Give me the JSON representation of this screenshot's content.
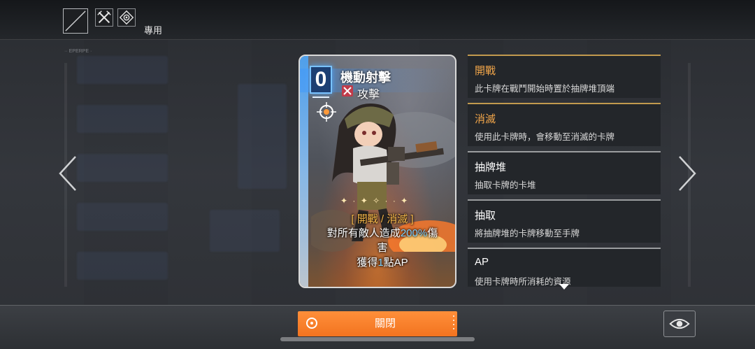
{
  "header": {
    "filter_icons": [
      "empty-slash-icon",
      "crossed-swords-icon",
      "target-icon"
    ],
    "filter_label": "專用",
    "small_caption": "·· EPERPE ·"
  },
  "card": {
    "cost": "0",
    "name": "機動射擊",
    "type_icon": "crossed-swords-icon",
    "type": "攻擊",
    "tags": "[ 開戰 / 消滅 ]",
    "effect_line1_pre": "對所有敵人造成",
    "effect_line1_value": "200%",
    "effect_line1_post": "傷",
    "effect_line2": "害",
    "effect_line3_pre": "獲得",
    "effect_line3_value": "1",
    "effect_line3_post": "點AP",
    "accent_color": "#4aa8ff",
    "highlight_color": "#7fd4ff"
  },
  "keywords": [
    {
      "title": "開戰",
      "desc": "此卡牌在戰鬥開始時置於抽牌堆頂端",
      "accent": "gold"
    },
    {
      "title": "消滅",
      "desc": "使用此卡牌時，會移動至消滅的卡牌",
      "accent": "gold"
    },
    {
      "title": "抽牌堆",
      "desc": "抽取卡牌的卡堆",
      "accent": "plain"
    },
    {
      "title": "抽取",
      "desc": "將抽牌堆的卡牌移動至手牌",
      "accent": "plain"
    },
    {
      "title": "AP",
      "desc": "使用卡牌時所消耗的資源",
      "accent": "plain"
    }
  ],
  "footer": {
    "close_label": "關閉",
    "close_icon": "target-circle-icon",
    "view_icon": "eye-icon",
    "button_color": "#f2731f"
  },
  "navigation": {
    "prev_icon": "chevron-left-icon",
    "next_icon": "chevron-right-icon"
  }
}
